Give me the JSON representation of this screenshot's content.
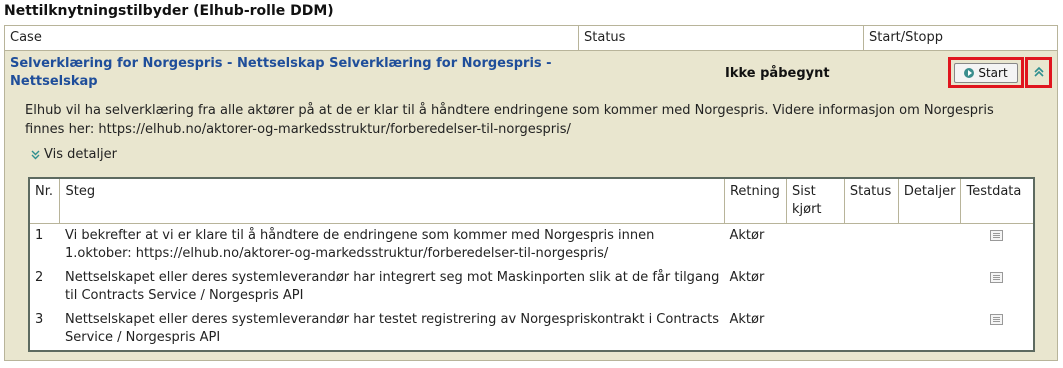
{
  "section": {
    "title": "Nettilknytningstilbyder (Elhub-rolle DDM)"
  },
  "header": {
    "case": "Case",
    "status": "Status",
    "start_stop": "Start/Stopp"
  },
  "case": {
    "title": "Selverklæring for Norgespris - Nettselskap Selverklæring for Norgespris - Nettselskap",
    "status": "Ikke påbegynt",
    "start_label": "Start",
    "description": "Elhub vil ha selverklæring fra alle aktører på at de er klar til å håndtere endringene som kommer med Norgespris. Videre informasjon om Norgespris finnes her: https://elhub.no/aktorer-og-markedsstruktur/forberedelser-til-norgespris/",
    "details_label": "Vis detaljer"
  },
  "steps_table": {
    "headers": {
      "nr": "Nr.",
      "step": "Steg",
      "direction": "Retning",
      "last_run": "Sist kjørt",
      "status": "Status",
      "details": "Detaljer",
      "testdata": "Testdata"
    },
    "rows": [
      {
        "nr": "1",
        "step": "Vi bekrefter at vi er klare til å håndtere de endringene som kommer med Norgespris innen 1.oktober: https://elhub.no/aktorer-og-markedsstruktur/forberedelser-til-norgespris/",
        "direction": "Aktør",
        "last_run": "",
        "status": "",
        "details": ""
      },
      {
        "nr": "2",
        "step": "Nettselskapet eller deres systemleverandør har integrert seg mot Maskinporten slik at de får tilgang til Contracts Service / Norgespris API",
        "direction": "Aktør",
        "last_run": "",
        "status": "",
        "details": ""
      },
      {
        "nr": "3",
        "step": "Nettselskapet eller deres systemleverandør har testet registrering av Norgespriskontrakt i Contracts Service / Norgespris API",
        "direction": "Aktør",
        "last_run": "",
        "status": "",
        "details": ""
      }
    ]
  },
  "icons": {
    "start": "play-circle-icon",
    "collapse": "double-chevron-up-icon",
    "details_toggle": "double-chevron-down-icon",
    "testdata": "document-icon"
  },
  "colors": {
    "panel_bg": "#e9e6cf",
    "case_title": "#1f4e9a",
    "highlight": "#e0151e",
    "icon_accent": "#2f8f8f"
  }
}
